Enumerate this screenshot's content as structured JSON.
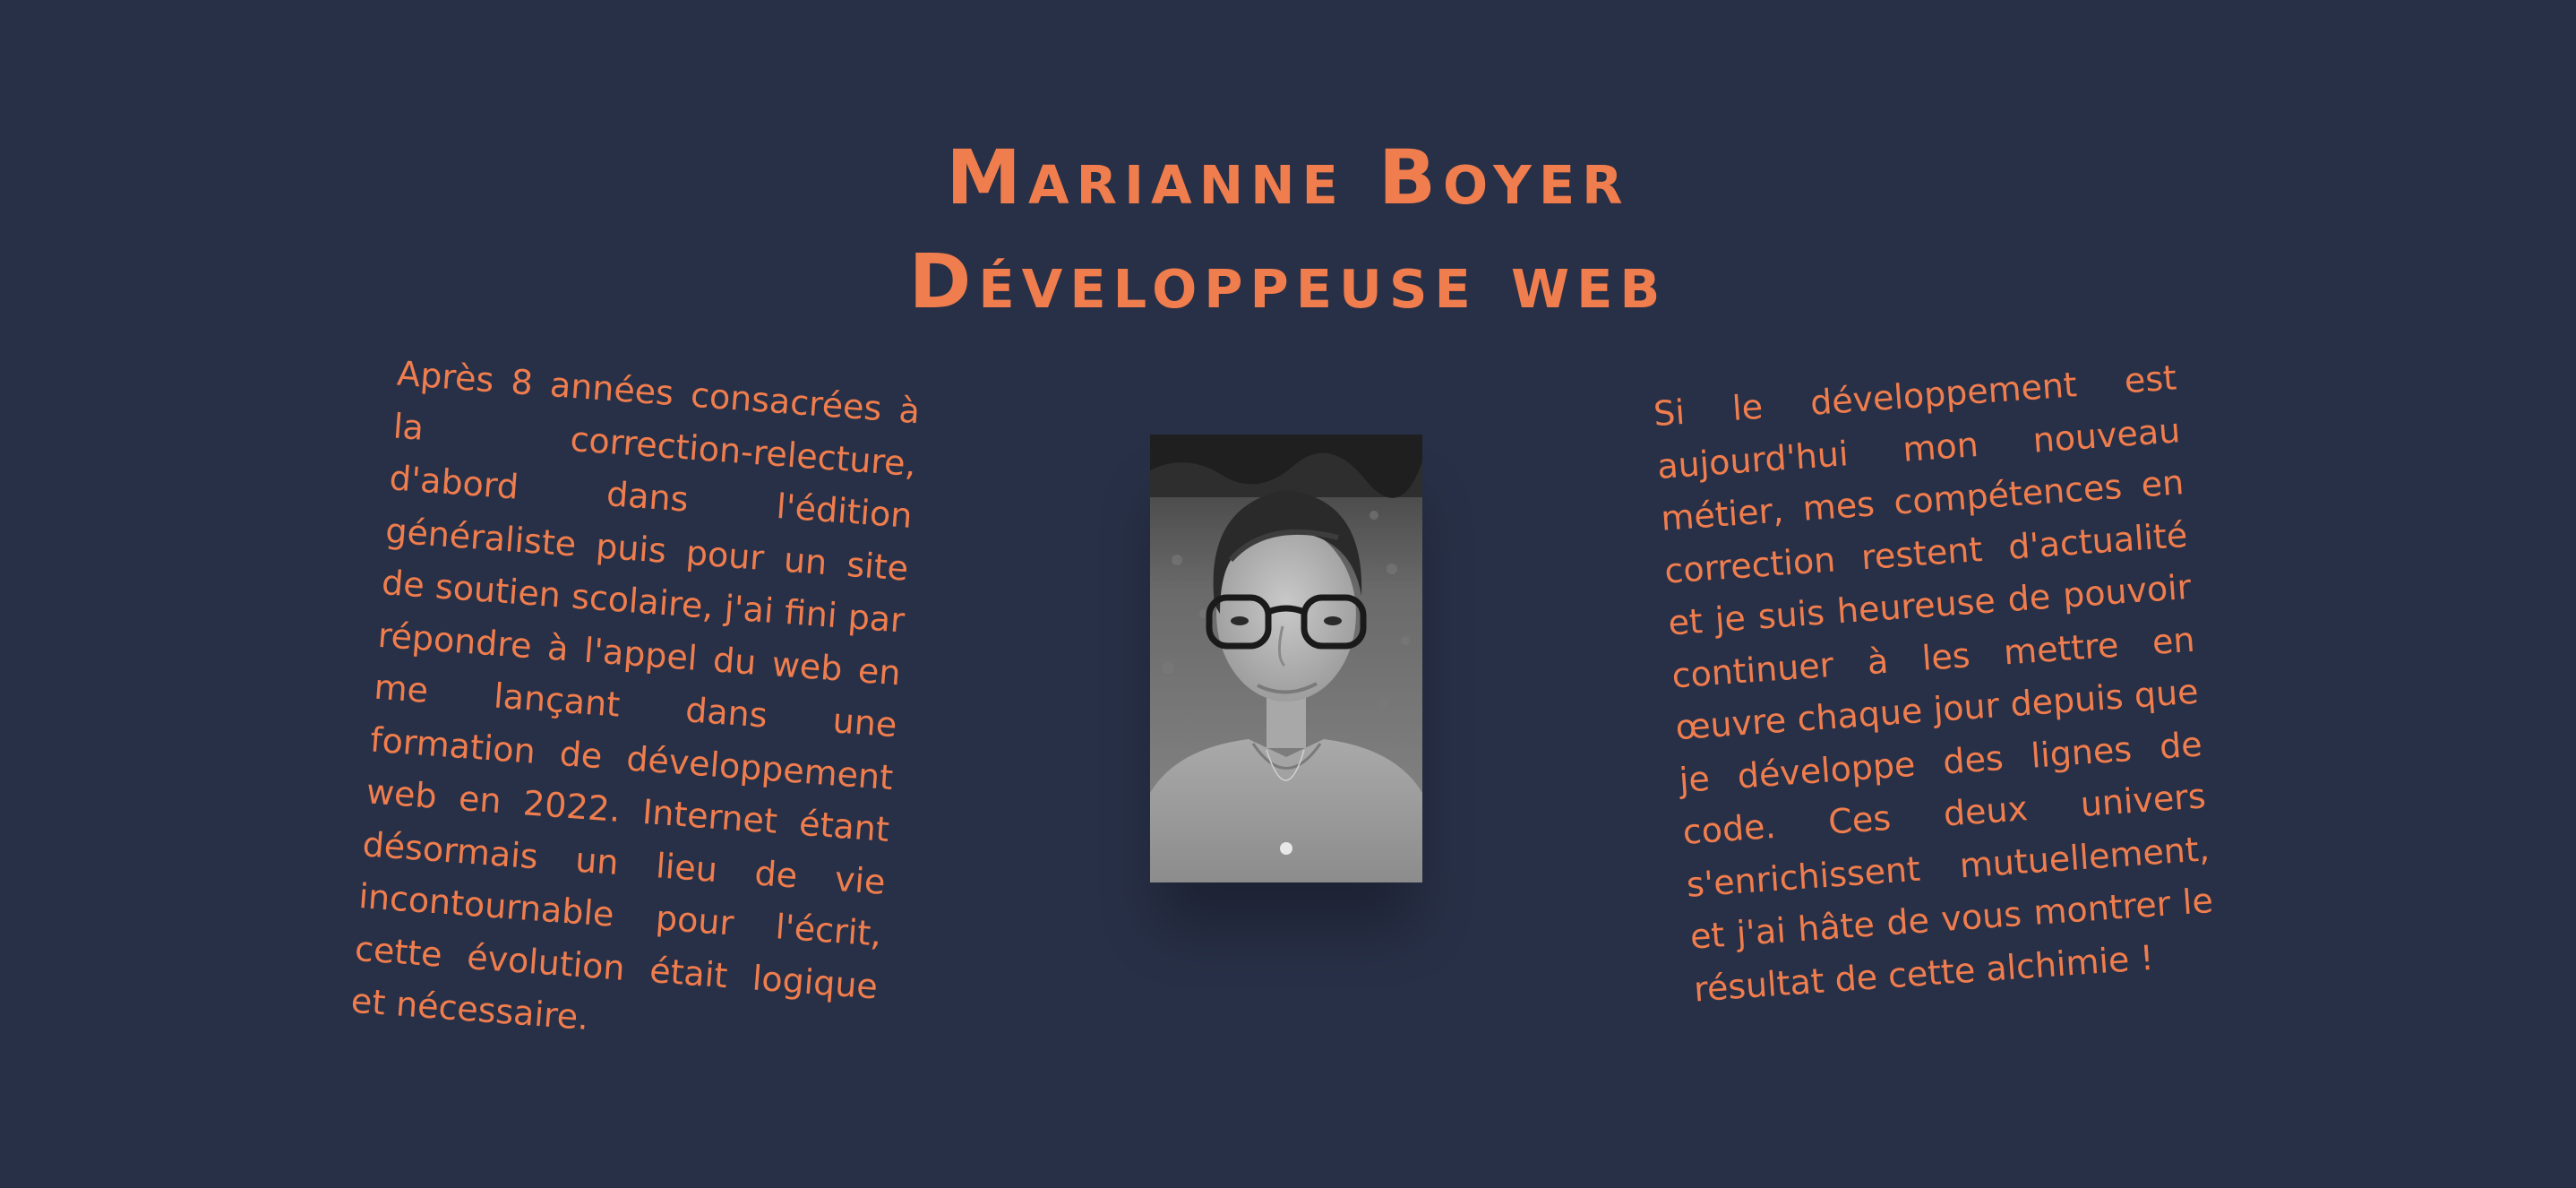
{
  "header": {
    "name": "Marianne Boyer",
    "role": "Développeuse web"
  },
  "left_text": "Après 8 années consacrées à la correction-relecture, d'abord dans l'édition généraliste puis pour un site de soutien scolaire, j'ai fini par répondre à l'appel du web en me lançant dans une formation de développement web en 2022. Internet étant désormais un lieu de vie incontournable pour l'écrit, cette évolution était logique et nécessaire.",
  "right_text": "Si le développement est aujourd'hui mon nouveau métier, mes compétences en correction restent d'actualité et je suis heureuse de pouvoir continuer à les mettre en œuvre chaque jour depuis que je développe des lignes de code. Ces deux univers s'enrichissent mutuellement, et j'ai hâte de vous montrer le résultat de cette alchimie !",
  "colors": {
    "background": "#283047",
    "accent": "#f07d4d"
  },
  "portrait": {
    "icon": "portrait-photo"
  }
}
